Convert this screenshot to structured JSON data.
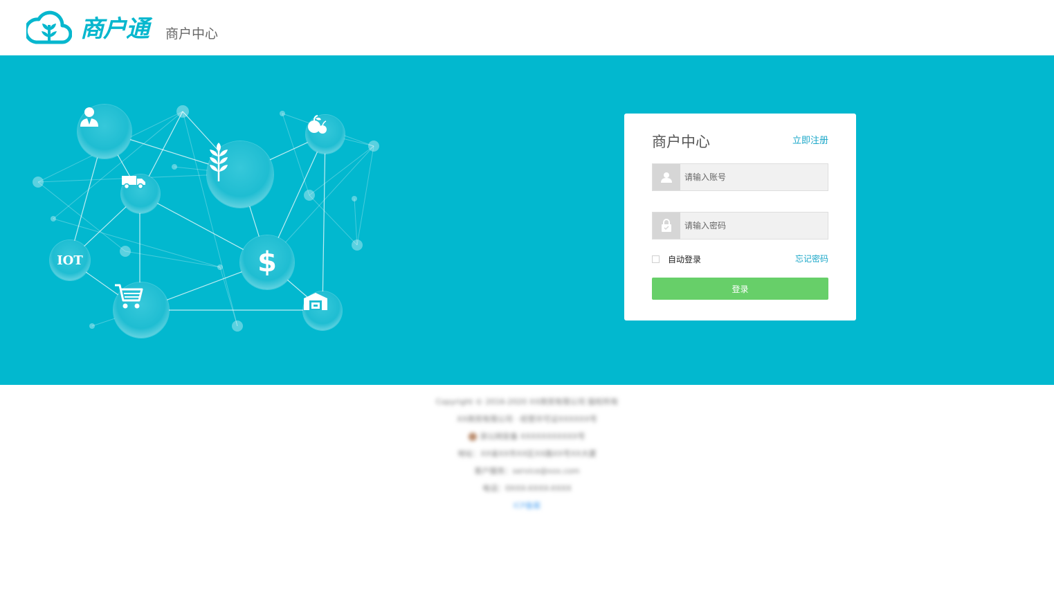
{
  "header": {
    "brand": "商户通",
    "subtitle": "商户中心"
  },
  "banner": {
    "nodes": [
      {
        "name": "user",
        "icon": "user-icon"
      },
      {
        "name": "wheat",
        "icon": "wheat-icon"
      },
      {
        "name": "fruit",
        "icon": "fruit-icon"
      },
      {
        "name": "truck",
        "icon": "truck-icon"
      },
      {
        "name": "iot",
        "label": "IOT"
      },
      {
        "name": "dollar",
        "label": "$"
      },
      {
        "name": "cart",
        "icon": "shopping-cart-icon"
      },
      {
        "name": "warehouse",
        "icon": "warehouse-icon"
      }
    ]
  },
  "login": {
    "title": "商户中心",
    "register_link": "立即注册",
    "username_placeholder": "请输入账号",
    "password_placeholder": "请输入密码",
    "remember_label": "自动登录",
    "forgot_link": "忘记密码",
    "submit_label": "登录"
  },
  "footer": {
    "lines": [
      "Copyright © 2016-2020 XX商贸有限公司 版权所有",
      "XX商贸有限公司 · 经营许可证XXXXXX号",
      "浙公网安备 XXXXXXXXXXX号",
      "地址：XX省XX市XX区XX路XX号XX大厦",
      "客户服务：service@xxx.com",
      "电话：0XXX-XXXX-XXXX"
    ],
    "link": "ICP备案"
  },
  "colors": {
    "accent": "#02b8cf",
    "link": "#1aa7c8",
    "button": "#67cf69"
  }
}
